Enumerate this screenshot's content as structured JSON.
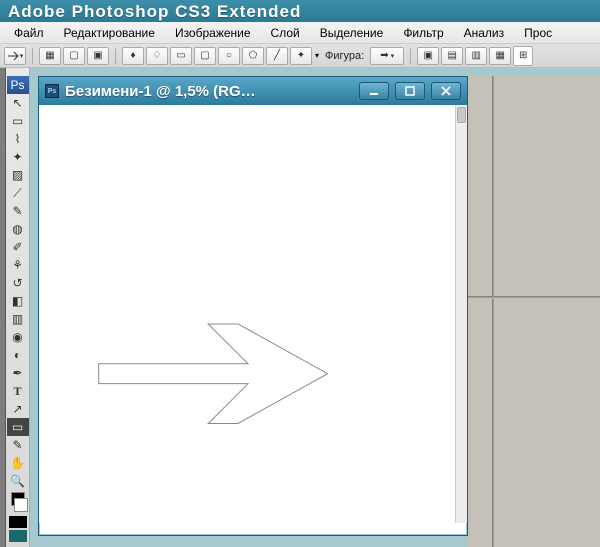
{
  "app": {
    "title": "Adobe Photoshop CS3 Extended"
  },
  "menu": {
    "file": "Файл",
    "edit": "Редактирование",
    "image": "Изображение",
    "layer": "Слой",
    "select": "Выделение",
    "filter": "Фильтр",
    "analysis": "Анализ",
    "view": "Прос"
  },
  "options": {
    "shape_label": "Фигура:"
  },
  "document": {
    "title": "Безимени-1 @ 1,5% (RG…"
  },
  "icons": {
    "ps": "Ps",
    "move": "↖",
    "marquee": "▭",
    "lasso": "⌇",
    "wand": "✦",
    "crop": "▨",
    "slice": "⟋",
    "eyedrop": "✎",
    "heal": "◍",
    "brush": "✐",
    "stamp": "⚘",
    "history": "↺",
    "eraser": "◧",
    "gradient": "▥",
    "blur": "◉",
    "dodge": "◐",
    "pen": "✒",
    "type": "T",
    "path": "↗",
    "shape": "▭",
    "notes": "✎",
    "hand": "✋",
    "zoom": "🔍",
    "arrow_preview": "➡"
  }
}
